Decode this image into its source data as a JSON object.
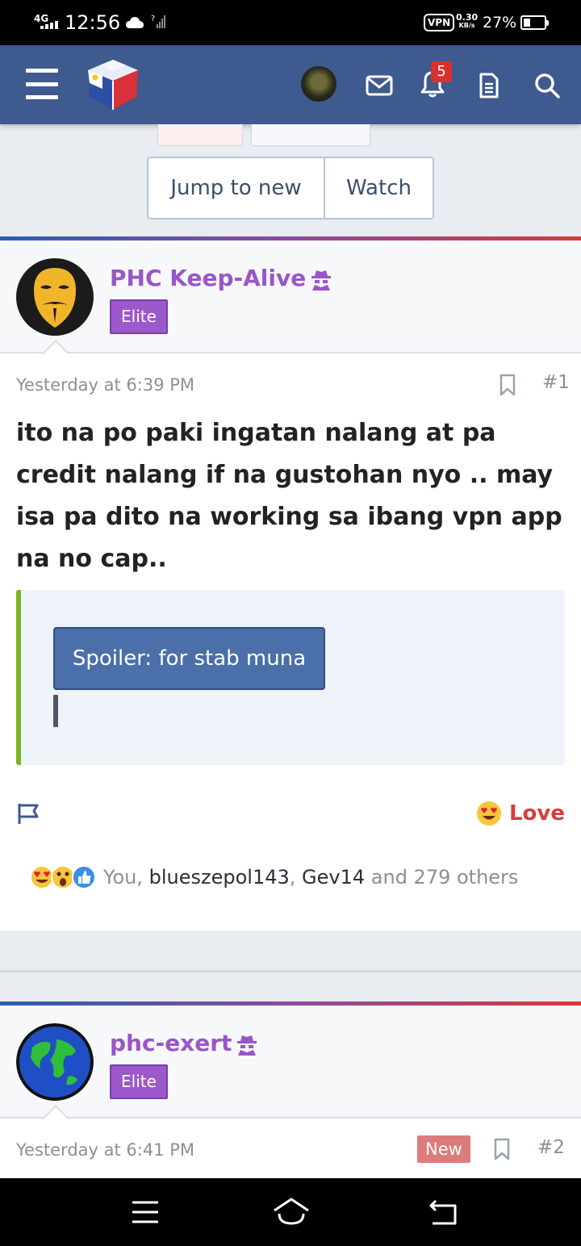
{
  "status_bar": {
    "network": "4G",
    "time": "12:56",
    "sim_label": "?",
    "vpn": "VPN",
    "speed_value": "0.30",
    "speed_unit": "KB/s",
    "battery": "27%"
  },
  "header": {
    "notification_count": "5"
  },
  "thread_actions": {
    "jump_label": "Jump to new",
    "watch_label": "Watch"
  },
  "posts": [
    {
      "username": "PHC Keep-Alive",
      "rank": "Elite",
      "date": "Yesterday at 6:39 PM",
      "number": "#1",
      "body": "ito na po paki ingatan nalang at pa credit nalang if na gustohan nyo .. may isa pa dito na working sa ibang vpn app na no cap..",
      "spoiler_label": "Spoiler: for stab muna",
      "reaction_label": "Love",
      "reactions_prefix": "You, ",
      "reactions_user1": "blueszepol143",
      "reactions_sep": ", ",
      "reactions_user2": "Gev14",
      "reactions_suffix": " and 279 others"
    },
    {
      "username": "phc-exert",
      "rank": "Elite",
      "date": "Yesterday at 6:41 PM",
      "badge": "New",
      "number": "#2"
    }
  ],
  "colors": {
    "header_bg": "#3e5a8e",
    "username": "#9a56c8",
    "rank_bg": "#9d58cc",
    "spoiler_border": "#7ab51d",
    "love": "#d93d3d",
    "new_badge": "#dc7b7b"
  },
  "icons": {
    "menu": "hamburger-menu-icon",
    "mail": "envelope-icon",
    "alerts": "bell-icon",
    "doc": "document-icon",
    "search": "search-icon",
    "bookmark": "bookmark-icon",
    "report": "flag-icon"
  }
}
